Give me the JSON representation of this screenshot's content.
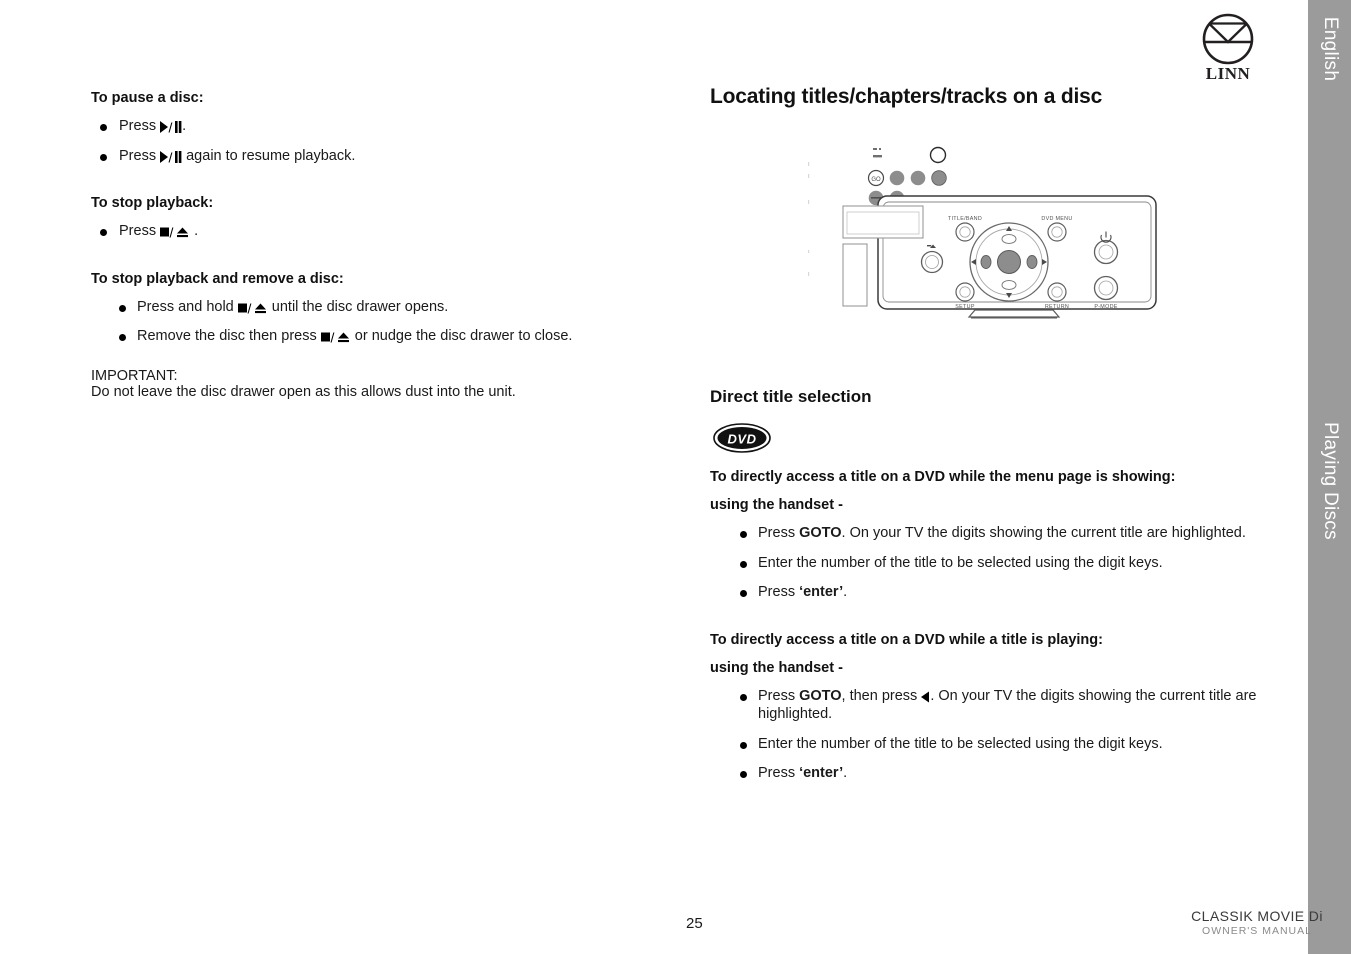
{
  "sidebar": {
    "language_tab": "English",
    "section_tab": "Playing Discs",
    "color": "#9b9b9b"
  },
  "logo": {
    "wordmark": "LINN",
    "icon": "linn-circle-logo"
  },
  "left_column": {
    "blocks": [
      {
        "heading": "To pause a disc:",
        "bullets": [
          {
            "pre": "Press ",
            "glyph": "play-pause",
            "post": "."
          },
          {
            "pre": "Press ",
            "glyph": "play-pause",
            "post": " again to resume playback."
          }
        ]
      },
      {
        "heading": "To stop playback:",
        "bullets": [
          {
            "pre": "Press ",
            "glyph": "stop-eject",
            "post": " ."
          }
        ]
      },
      {
        "heading": "To stop playback and remove a disc:",
        "bullets": [
          {
            "pre": "Press and hold  ",
            "glyph": "stop-eject",
            "post": "  until the disc drawer opens."
          },
          {
            "pre": "Remove the disc then press ",
            "glyph": "stop-eject",
            "post": "  or nudge the disc drawer to close."
          }
        ]
      }
    ],
    "important_label": "IMPORTANT:",
    "important_text": "Do not leave the disc drawer open as this allows dust into the unit."
  },
  "right_column": {
    "section_heading": "Locating titles/chapters/tracks on a disc",
    "illustration": {
      "name": "classik-movie-front-panel-and-handset",
      "panel_labels": {
        "title_band": "TITLE/BAND",
        "dvd_menu": "DVD MENU",
        "setup": "SETUP",
        "return": "RETURN",
        "p_mode": "P-MODE"
      }
    },
    "sub_heading": "Direct title selection",
    "disc_badge": "DVD",
    "groups": [
      {
        "heading": "To directly access a title on a DVD while the menu page is showing:",
        "subheading": "using the handset -",
        "bullets": [
          {
            "segments": [
              {
                "t": "Press ",
                "b": false
              },
              {
                "t": "GOTO",
                "b": true
              },
              {
                "t": ". On your TV the digits showing the current title are highlighted.",
                "b": false
              }
            ]
          },
          {
            "segments": [
              {
                "t": "Enter the number of the title to be selected using the digit keys.",
                "b": false
              }
            ]
          },
          {
            "segments": [
              {
                "t": "Press ",
                "b": false
              },
              {
                "t": "‘enter’",
                "b": true
              },
              {
                "t": ".",
                "b": false
              }
            ]
          }
        ]
      },
      {
        "heading": "To directly access a title on a DVD while a title is playing:",
        "subheading": "using the handset -",
        "bullets": [
          {
            "segments": [
              {
                "t": "Press ",
                "b": false
              },
              {
                "t": "GOTO",
                "b": true
              },
              {
                "t": ", then press ",
                "b": false
              },
              {
                "t": "◀",
                "b": false,
                "glyph": "left-triangle"
              },
              {
                "t": ". On your TV the digits showing the current title are highlighted.",
                "b": false
              }
            ]
          },
          {
            "segments": [
              {
                "t": "Enter the number of the title to be selected using the digit keys.",
                "b": false
              }
            ]
          },
          {
            "segments": [
              {
                "t": "Press ",
                "b": false
              },
              {
                "t": "‘enter’",
                "b": true
              },
              {
                "t": ".",
                "b": false
              }
            ]
          }
        ]
      }
    ]
  },
  "footer": {
    "page_number": "25",
    "model": "CLASSIK MOVIE Di",
    "manual_label": "OWNER'S MANUAL"
  }
}
